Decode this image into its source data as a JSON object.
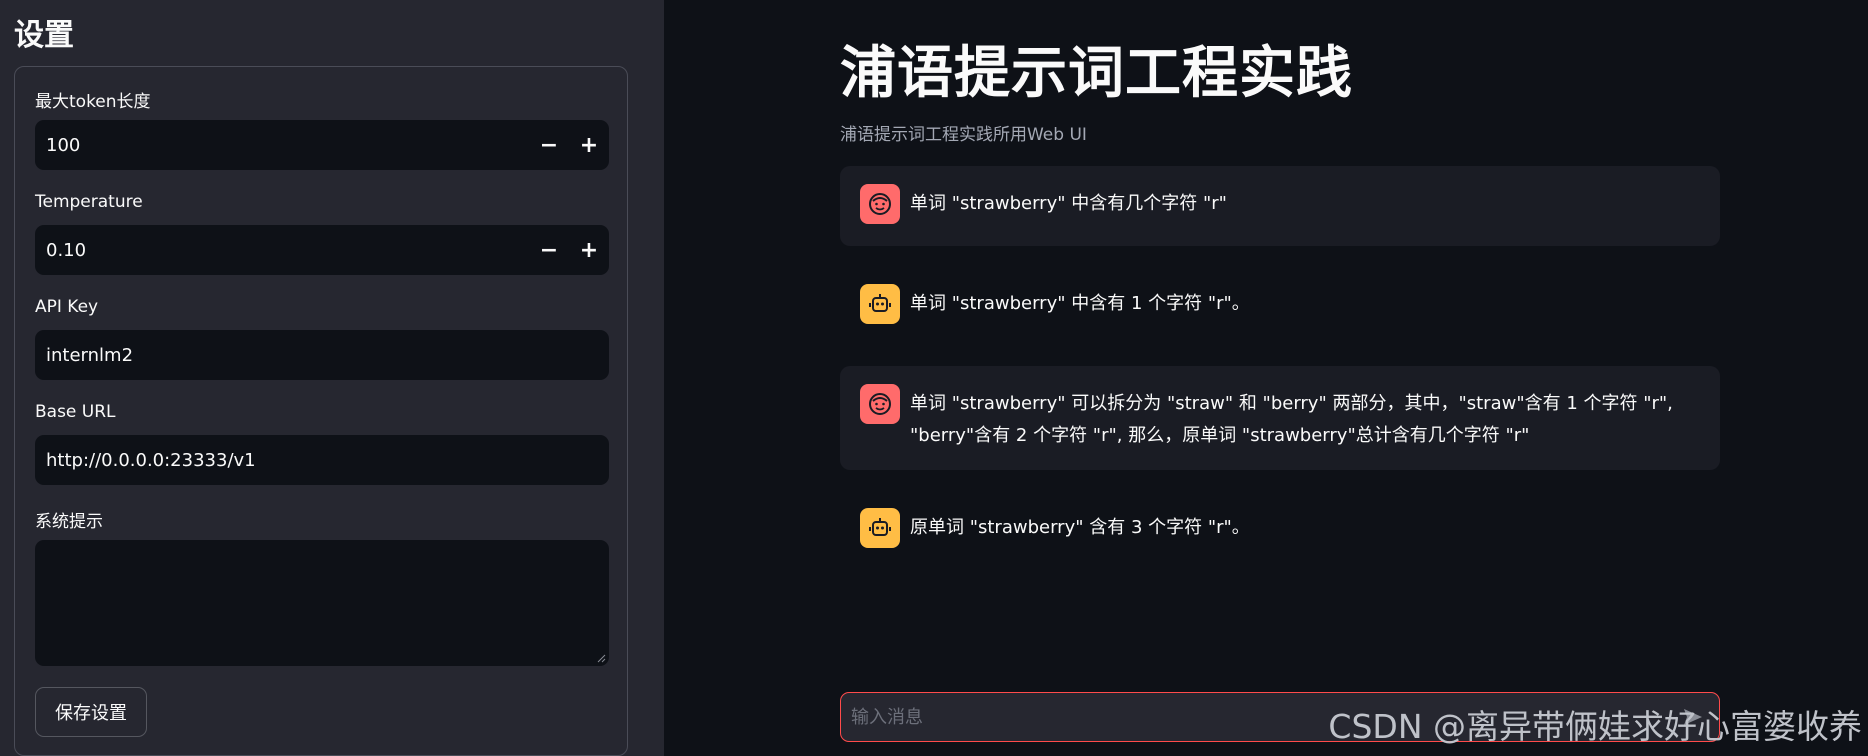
{
  "sidebar": {
    "title": "设置",
    "max_tokens": {
      "label": "最大token长度",
      "value": "100",
      "minus": "−",
      "plus": "+"
    },
    "temperature": {
      "label": "Temperature",
      "value": "0.10",
      "minus": "−",
      "plus": "+"
    },
    "api_key": {
      "label": "API Key",
      "value": "internlm2"
    },
    "base_url": {
      "label": "Base URL",
      "value": "http://0.0.0.0:23333/v1"
    },
    "system_prompt": {
      "label": "系统提示",
      "value": ""
    },
    "save_label": "保存设置"
  },
  "main": {
    "title": "浦语提示词工程实践",
    "caption": "浦语提示词工程实践所用Web UI",
    "messages": [
      {
        "role": "user",
        "text": "单词 \"strawberry\" 中含有几个字符 \"r\""
      },
      {
        "role": "assistant",
        "text": "单词 \"strawberry\" 中含有 1 个字符 \"r\"。"
      },
      {
        "role": "user",
        "text": "单词 \"strawberry\" 可以拆分为 \"straw\" 和 \"berry\" 两部分，其中，\"straw\"含有 1 个字符 \"r\", \"berry\"含有 2 个字符 \"r\", 那么，原单词 \"strawberry\"总计含有几个字符 \"r\""
      },
      {
        "role": "assistant",
        "text": "原单词 \"strawberry\" 含有 3 个字符 \"r\"。"
      }
    ],
    "input_placeholder": "输入消息"
  },
  "watermark": "CSDN @离异带俩娃求好心富婆收养",
  "colors": {
    "sidebar_bg": "#262730",
    "main_bg": "#0e1117",
    "user_avatar": "#ff6b6b",
    "bot_avatar": "#ffbd45",
    "input_border": "#ff4b4b"
  },
  "icons": {
    "user_avatar": "smile-face-icon",
    "bot_avatar": "robot-icon",
    "send": "send-icon"
  }
}
